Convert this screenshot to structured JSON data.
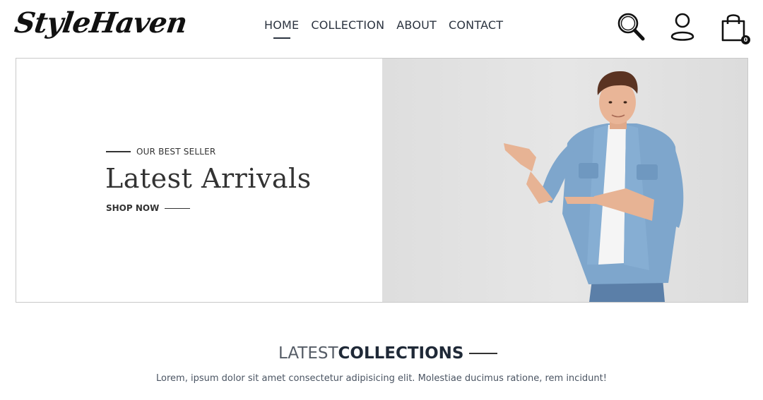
{
  "brand": {
    "logo": "StyleHaven"
  },
  "nav": {
    "items": [
      {
        "label": "HOME",
        "active": true
      },
      {
        "label": "COLLECTION",
        "active": false
      },
      {
        "label": "ABOUT",
        "active": false
      },
      {
        "label": "CONTACT",
        "active": false
      }
    ]
  },
  "header_icons": {
    "search": "search-icon",
    "profile": "user-icon",
    "cart": "shopping-bag-icon",
    "cart_count": "0"
  },
  "hero": {
    "eyebrow": "OUR BEST SELLER",
    "title": "Latest Arrivals",
    "cta": "SHOP NOW",
    "image": "man in denim shirt pointing"
  },
  "collections": {
    "title_light": "LATEST",
    "title_bold": "COLLECTIONS",
    "description": "Lorem, ipsum dolor sit amet consectetur adipisicing elit. Molestiae ducimus ratione, rem incidunt!"
  },
  "colors": {
    "text_dark": "#1f2937",
    "text_body": "#4b5563",
    "hero_bg": "#e2e2e2",
    "denim": "#7ea6cc"
  }
}
